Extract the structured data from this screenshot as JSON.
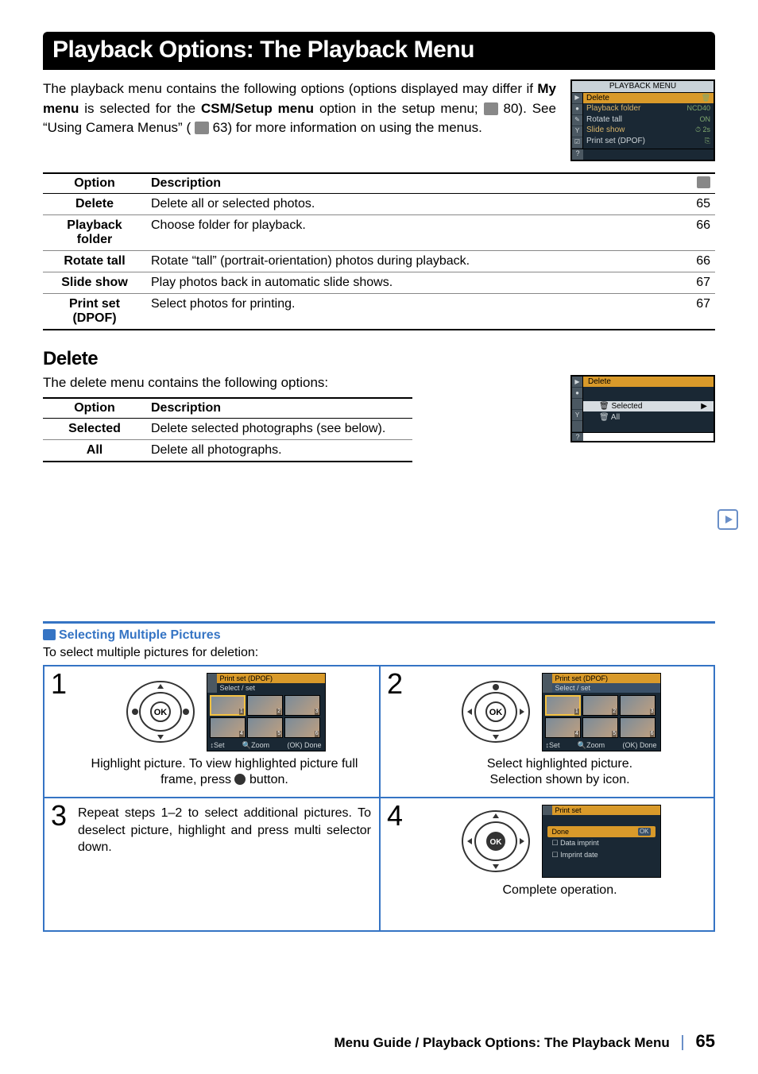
{
  "banner_title": "Playback Options: The Playback Menu",
  "intro": {
    "text_a": "The playback menu contains the following options (options displayed may differ if ",
    "bold_a": "My menu",
    "text_b": " is selected for the ",
    "bold_b": "CSM/Setup menu",
    "text_c": " option in the setup menu; ",
    "ref_a": " 80).  See “Using Camera Menus” (",
    "ref_b": " 63) for more information on using the menus."
  },
  "lcd_playback": {
    "title": "PLAYBACK MENU",
    "rows": [
      {
        "label": "Delete",
        "right": "🗑",
        "sel": true
      },
      {
        "label": "Playback folder",
        "right": "NCD40"
      },
      {
        "label": "Rotate tall",
        "right": "ON"
      },
      {
        "label": "Slide show",
        "right": "⏱ 2s"
      },
      {
        "label": "Print set (DPOF)",
        "right": "⎘"
      }
    ],
    "sidebar_icons": [
      "▶",
      "●",
      "✎",
      "Υ",
      "☑"
    ],
    "footer_icon": "?"
  },
  "options_table": {
    "headers": {
      "option": "Option",
      "desc": "Description"
    },
    "rows": [
      {
        "option": "Delete",
        "desc": "Delete all or selected photos.",
        "page": "65"
      },
      {
        "option": "Playback folder",
        "desc": "Choose folder for playback.",
        "page": "66"
      },
      {
        "option": "Rotate tall",
        "desc": "Rotate “tall” (portrait-orientation) photos during playback.",
        "page": "66"
      },
      {
        "option": "Slide show",
        "desc": "Play photos back in automatic slide shows.",
        "page": "67"
      },
      {
        "option": "Print set (DPOF)",
        "desc": "Select photos for printing.",
        "page": "67"
      }
    ]
  },
  "delete_section": {
    "heading": "Delete",
    "intro": "The delete menu contains the following options:",
    "headers": {
      "option": "Option",
      "desc": "Description"
    },
    "rows": [
      {
        "option": "Selected",
        "desc": "Delete selected photographs (see below)."
      },
      {
        "option": "All",
        "desc": "Delete all photographs."
      }
    ],
    "lcd": {
      "title": "Delete",
      "row_selected": "Selected",
      "row_all": "All",
      "sidebar_icons": [
        "▶",
        "●",
        "",
        "Υ",
        ""
      ],
      "footer_icon": "?"
    }
  },
  "sel_box": {
    "title": "Selecting Multiple Pictures",
    "subtitle": "To select multiple pictures for deletion:",
    "steps": {
      "s1_num": "1",
      "s1_cap_a": "Highlight picture.  To view highlighted picture full frame, press ",
      "s1_cap_b": " button.",
      "s2_num": "2",
      "s2_cap": "Select highlighted picture.\nSelection shown by icon.",
      "s3_num": "3",
      "s3_text": "Repeat steps 1–2 to select additional pictures.  To deselect picture, highlight and press multi selector down.",
      "s4_num": "4",
      "s4_cap": "Complete operation."
    },
    "step_lcds": {
      "ps_title": "Print set (DPOF)",
      "ps_sub": "Select / set",
      "thumbs": [
        "1",
        "2",
        "3",
        "4",
        "5",
        "6"
      ],
      "ftr_set": "↕Set",
      "ftr_zoom": "🔍Zoom",
      "ftr_done": "(OK) Done",
      "done_title": "Print set",
      "done_rows": [
        {
          "label": "Done",
          "ok": true,
          "high": true
        },
        {
          "label": "Data imprint",
          "chk": true
        },
        {
          "label": "Imprint date",
          "chk": true
        }
      ]
    }
  },
  "footer": {
    "text": "Menu Guide / Playback Options: The Playback Menu",
    "page": "65"
  }
}
